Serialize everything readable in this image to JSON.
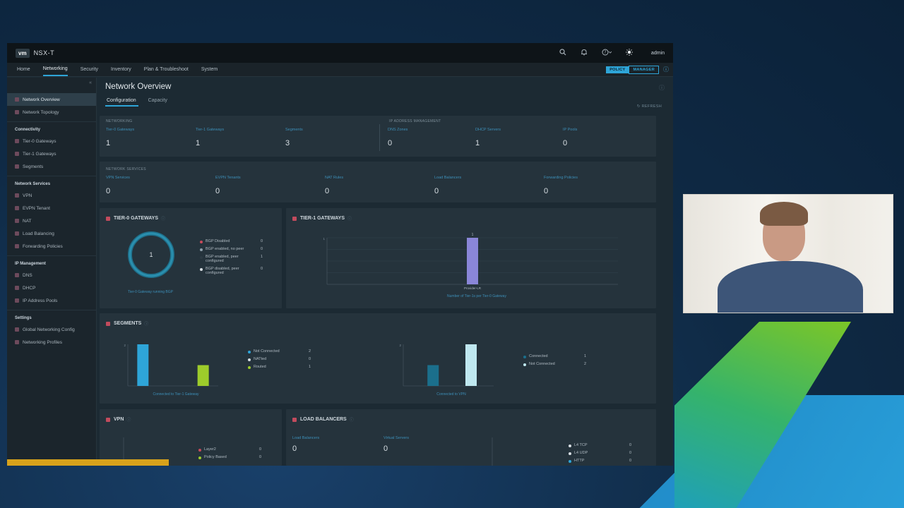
{
  "window": {
    "title": "NSX-T",
    "logo": "vm",
    "user": "admin"
  },
  "nav": {
    "items": [
      {
        "label": "Home"
      },
      {
        "label": "Networking"
      },
      {
        "label": "Security"
      },
      {
        "label": "Inventory"
      },
      {
        "label": "Plan & Troubleshoot"
      },
      {
        "label": "System"
      }
    ],
    "active": "Networking",
    "mode_policy": "POLICY",
    "mode_manager": "MANAGER"
  },
  "sidebar": {
    "top_items": [
      {
        "label": "Network Overview"
      },
      {
        "label": "Network Topology"
      }
    ],
    "sections": [
      {
        "title": "Connectivity",
        "items": [
          {
            "label": "Tier-0 Gateways"
          },
          {
            "label": "Tier-1 Gateways"
          },
          {
            "label": "Segments"
          }
        ]
      },
      {
        "title": "Network Services",
        "items": [
          {
            "label": "VPN"
          },
          {
            "label": "EVPN Tenant"
          },
          {
            "label": "NAT"
          },
          {
            "label": "Load Balancing"
          },
          {
            "label": "Forwarding Policies"
          }
        ]
      },
      {
        "title": "IP Management",
        "items": [
          {
            "label": "DNS"
          },
          {
            "label": "DHCP"
          },
          {
            "label": "IP Address Pools"
          }
        ]
      },
      {
        "title": "Settings",
        "items": [
          {
            "label": "Global Networking Config"
          },
          {
            "label": "Networking Profiles"
          }
        ]
      }
    ]
  },
  "page": {
    "title": "Network Overview",
    "tabs": [
      {
        "label": "Configuration"
      },
      {
        "label": "Capacity"
      }
    ],
    "refresh": "REFRESH"
  },
  "networking": {
    "label": "NETWORKING",
    "stats": [
      {
        "name": "Tier-0 Gateways",
        "value": "1"
      },
      {
        "name": "Tier-1 Gateways",
        "value": "1"
      },
      {
        "name": "Segments",
        "value": "3"
      }
    ]
  },
  "ipam": {
    "label": "IP ADDRESS MANAGEMENT",
    "stats": [
      {
        "name": "DNS Zones",
        "value": "0"
      },
      {
        "name": "DHCP Servers",
        "value": "1"
      },
      {
        "name": "IP Pools",
        "value": "0"
      }
    ]
  },
  "services": {
    "label": "NETWORK SERVICES",
    "stats": [
      {
        "name": "VPN Services",
        "value": "0"
      },
      {
        "name": "EVPN Tenants",
        "value": "0"
      },
      {
        "name": "NAT Rules",
        "value": "0"
      },
      {
        "name": "Load Balancers",
        "value": "0"
      },
      {
        "name": "Forwarding Policies",
        "value": "0"
      }
    ]
  },
  "tier0": {
    "title": "TIER-0 GATEWAYS",
    "donut_value": "1",
    "caption": "Tier-0 Gateway running BGP",
    "legend": [
      {
        "label": "BGP Disabled",
        "value": "0",
        "color": "#c94b5a"
      },
      {
        "label": "BGP enabled, no peer",
        "value": "0",
        "color": "#8fa0ab"
      },
      {
        "label": "BGP enabled, peer configured",
        "value": "1",
        "color": "#2d3b44"
      },
      {
        "label": "BGP disabled, peer configured",
        "value": "0",
        "color": "#d7dee3"
      }
    ]
  },
  "tier1": {
    "title": "TIER-1 GATEWAYS",
    "caption": "Number of Tier-1s per Tier-0 Gateway"
  },
  "segments": {
    "title": "SEGMENTS",
    "caption_left": "Connected to Tier-1 Gateway",
    "caption_right": "Connected to VPN",
    "legend_left": [
      {
        "label": "Not Connected",
        "value": "2",
        "color": "#2ea5d8"
      },
      {
        "label": "NATted",
        "value": "0",
        "color": "#d7dee3"
      },
      {
        "label": "Routed",
        "value": "1",
        "color": "#9dcc2b"
      }
    ],
    "legend_right": [
      {
        "label": "Connected",
        "value": "1",
        "color": "#1b6f8c"
      },
      {
        "label": "Not Connected",
        "value": "2",
        "color": "#bfe8f0"
      }
    ]
  },
  "vpn": {
    "title": "VPN",
    "legend": [
      {
        "label": "Layer2",
        "value": "0",
        "color": "#c94b5a"
      },
      {
        "label": "Policy Based",
        "value": "0",
        "color": "#9dcc2b"
      }
    ]
  },
  "load_balancers": {
    "title": "LOAD BALANCERS",
    "stats": [
      {
        "name": "Load Balancers",
        "value": "0"
      },
      {
        "name": "Virtual Servers",
        "value": "0"
      }
    ],
    "legend": [
      {
        "label": "L4 TCP",
        "value": "0",
        "color": "#d7dee3"
      },
      {
        "label": "L4 UDP",
        "value": "0",
        "color": "#d7dee3"
      },
      {
        "label": "HTTP",
        "value": "0",
        "color": "#2ea5d8"
      }
    ]
  },
  "chart_data": [
    {
      "type": "bar",
      "title": "TIER-1 GATEWAYS",
      "categories": [
        "Provider-LR"
      ],
      "values": [
        1
      ],
      "data_labels": [
        "1"
      ],
      "xlabel": "Number of Tier-1s per Tier-0 Gateway",
      "ylim": [
        0,
        1
      ],
      "colors": [
        "#8a86d8"
      ]
    },
    {
      "type": "bar",
      "title": "SEGMENTS",
      "categories": [
        "Not Connected",
        "NATted",
        "Routed"
      ],
      "values": [
        2,
        0,
        1
      ],
      "xlabel": "Connected to Tier-1 Gateway",
      "ylim": [
        0,
        2
      ],
      "colors": [
        "#2ea5d8",
        "#d7dee3",
        "#9dcc2b"
      ]
    },
    {
      "type": "bar",
      "title": "SEGMENTS",
      "categories": [
        "Connected",
        "Not Connected"
      ],
      "values": [
        1,
        2
      ],
      "xlabel": "Connected to VPN",
      "ylim": [
        0,
        2
      ],
      "colors": [
        "#1b6f8c",
        "#bfe8f0"
      ]
    }
  ],
  "webcam": {
    "description_icon": "person-video"
  }
}
